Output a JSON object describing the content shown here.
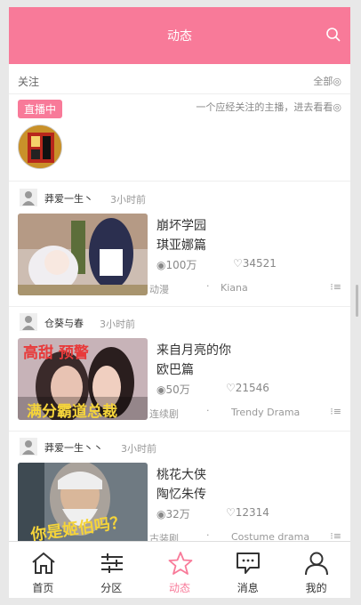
{
  "header": {
    "title": "动态"
  },
  "follow_bar": {
    "label": "关注",
    "filter": "全部◎"
  },
  "live": {
    "badge": "直播中",
    "hint": "一个应经关注的主播，进去看看◎"
  },
  "feed": [
    {
      "user": "莽爱一生丶",
      "time": "3小时前",
      "title_line1": "崩坏学园",
      "title_line2": "琪亚娜篇",
      "views": "◉100万",
      "likes": "♡34521",
      "category": "动漫",
      "tag": "Kiana",
      "dot": "·",
      "more": "⁝≡"
    },
    {
      "user": "仓葵与春",
      "time": "3小时前",
      "title_line1": "来自月亮的你",
      "title_line2": "欧巴篇",
      "views": "◉50万",
      "likes": "♡21546",
      "category": "连续剧",
      "tag": "Trendy Drama",
      "dot": "·",
      "more": "⁝≡",
      "thumb_text_1": "高甜 预警",
      "thumb_text_2": "满分霸道总裁"
    },
    {
      "user": "莽爱一生丶丶",
      "time": "3小时前",
      "title_line1": "桃花大侠",
      "title_line2": "陶忆朱传",
      "views": "◉32万",
      "likes": "♡12314",
      "category": "古装剧",
      "tag": "Costume drama",
      "dot": "·",
      "more": "⁝≡",
      "thumb_text_1": "你是姬伯吗？"
    }
  ],
  "tabs": [
    {
      "label": "首页",
      "icon": "home-icon"
    },
    {
      "label": "分区",
      "icon": "sliders-icon"
    },
    {
      "label": "动态",
      "icon": "star-icon",
      "active": true
    },
    {
      "label": "消息",
      "icon": "message-icon"
    },
    {
      "label": "我的",
      "icon": "user-icon"
    }
  ],
  "colors": {
    "accent": "#f87a99"
  }
}
